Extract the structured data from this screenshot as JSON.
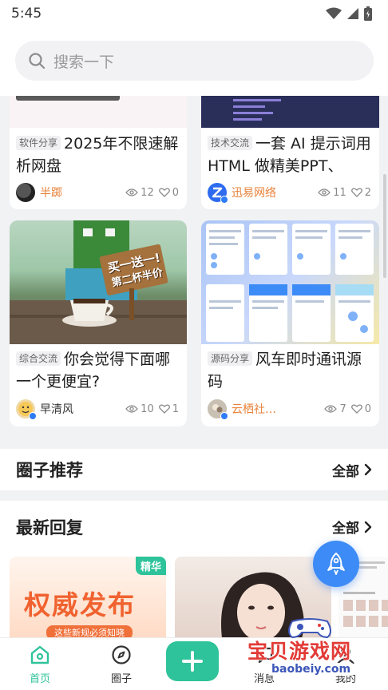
{
  "status_bar": {
    "time": "5:45"
  },
  "search": {
    "placeholder": "搜索一下"
  },
  "posts": [
    {
      "tag": "软件分享",
      "title": "2025年不限速解析网盘",
      "author": "半踯",
      "views": "12",
      "likes": "0",
      "author_color": "#e8823a"
    },
    {
      "tag": "技术交流",
      "title": "一套 AI 提示词用HTML 做精美PPT、简…",
      "author": "迅易网络",
      "views": "11",
      "likes": "2",
      "author_color": "#e8823a"
    },
    {
      "tag": "综合交流",
      "title": "你会觉得下面哪一个更便宜?",
      "author": "早清风",
      "views": "10",
      "likes": "1",
      "author_color": "#333333"
    },
    {
      "tag": "源码分享",
      "title": "风车即时通讯源码",
      "author": "云栖社…",
      "views": "7",
      "likes": "0",
      "author_color": "#e8823a"
    }
  ],
  "post_image_sign": {
    "line1": "买一送一!",
    "line2": "第二杯半价"
  },
  "sections": {
    "circles": {
      "title": "圈子推荐",
      "more": "全部"
    },
    "replies": {
      "title": "最新回复",
      "more": "全部"
    }
  },
  "reply_cards": [
    {
      "badge": "精华",
      "headline": "权威发布",
      "sub": "这些新规必须知晓"
    }
  ],
  "bottom_nav": {
    "home": "首页",
    "circle": "圈子",
    "messages": "消息",
    "mine": "我的"
  },
  "watermark": {
    "text": "宝贝游戏网",
    "url": "baobeiy.com"
  },
  "colors": {
    "accent": "#2ec39a",
    "float": "#3d8bf6",
    "author_orange": "#e8823a"
  }
}
